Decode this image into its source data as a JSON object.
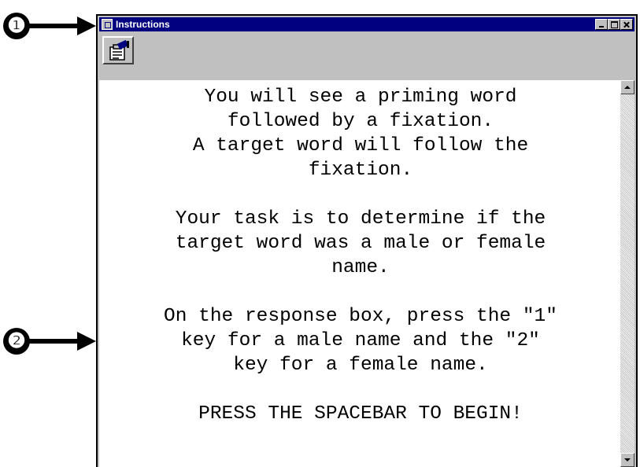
{
  "callouts": [
    "❶",
    "❷"
  ],
  "window": {
    "title": "Instructions"
  },
  "toolbar": {
    "properties_icon": "properties-icon"
  },
  "instructions": {
    "paragraph_1": "You will see a priming word\nfollowed by a fixation.\nA target word will follow the\nfixation.",
    "paragraph_2": "Your task is to determine if the\ntarget word was a male or female\nname.",
    "paragraph_3": "On the response box, press the \"1\"\nkey for a male name and the \"2\"\nkey for a female name.",
    "paragraph_4": "PRESS THE SPACEBAR TO BEGIN!"
  },
  "colors": {
    "titlebar": "#000080",
    "chrome": "#c0c0c0",
    "text": "#000000"
  }
}
